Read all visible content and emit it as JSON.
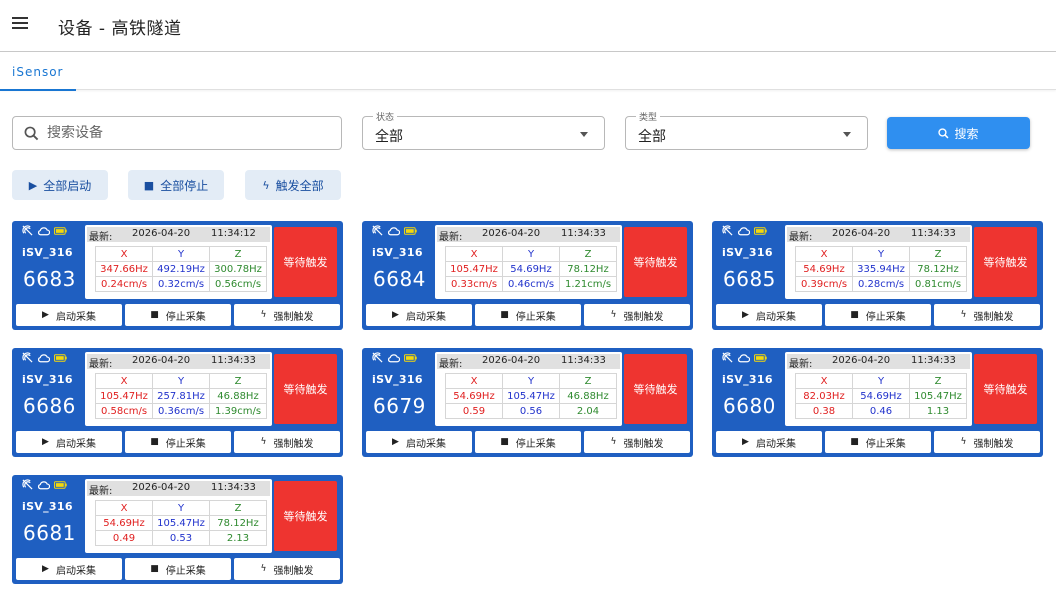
{
  "header": {
    "title": "设备 - 高铁隧道",
    "menu_icon": "hamburger-menu-icon"
  },
  "tabs": [
    {
      "label": "iSensor",
      "active": true
    }
  ],
  "filters": {
    "search_placeholder": "搜索设备",
    "status": {
      "legend": "状态",
      "value": "全部"
    },
    "type": {
      "legend": "类型",
      "value": "全部"
    },
    "search_button": "搜索"
  },
  "actions": {
    "start_all": "全部启动",
    "stop_all": "全部停止",
    "trigger_all": "触发全部"
  },
  "card_labels": {
    "latest": "最新:",
    "axes": [
      "X",
      "Y",
      "Z"
    ],
    "trigger_status": "等待触发",
    "start": "启动采集",
    "stop": "停止采集",
    "force": "强制触发"
  },
  "colors": {
    "primary": "#1f5fc1",
    "trigger": "#ee3430",
    "x": "#e02020",
    "y": "#2233cc",
    "z": "#2f8a2f",
    "search_button": "#2f8ff0"
  },
  "devices": [
    {
      "model": "iSV_316",
      "id": "6683",
      "date": "2026-04-20",
      "time": "11:34:12",
      "freq": [
        "347.66Hz",
        "492.19Hz",
        "300.78Hz"
      ],
      "vel": [
        "0.24cm/s",
        "0.32cm/s",
        "0.56cm/s"
      ]
    },
    {
      "model": "iSV_316",
      "id": "6684",
      "date": "2026-04-20",
      "time": "11:34:33",
      "freq": [
        "105.47Hz",
        "54.69Hz",
        "78.12Hz"
      ],
      "vel": [
        "0.33cm/s",
        "0.46cm/s",
        "1.21cm/s"
      ]
    },
    {
      "model": "iSV_316",
      "id": "6685",
      "date": "2026-04-20",
      "time": "11:34:33",
      "freq": [
        "54.69Hz",
        "335.94Hz",
        "78.12Hz"
      ],
      "vel": [
        "0.39cm/s",
        "0.28cm/s",
        "0.81cm/s"
      ]
    },
    {
      "model": "iSV_316",
      "id": "6686",
      "date": "2026-04-20",
      "time": "11:34:33",
      "freq": [
        "105.47Hz",
        "257.81Hz",
        "46.88Hz"
      ],
      "vel": [
        "0.58cm/s",
        "0.36cm/s",
        "1.39cm/s"
      ]
    },
    {
      "model": "iSV_316",
      "id": "6679",
      "date": "2026-04-20",
      "time": "11:34:33",
      "freq": [
        "54.69Hz",
        "105.47Hz",
        "46.88Hz"
      ],
      "vel": [
        "0.59",
        "0.56",
        "2.04"
      ]
    },
    {
      "model": "iSV_316",
      "id": "6680",
      "date": "2026-04-20",
      "time": "11:34:33",
      "freq": [
        "82.03Hz",
        "54.69Hz",
        "105.47Hz"
      ],
      "vel": [
        "0.38",
        "0.46",
        "1.13"
      ]
    },
    {
      "model": "iSV_316",
      "id": "6681",
      "date": "2026-04-20",
      "time": "11:34:33",
      "freq": [
        "54.69Hz",
        "105.47Hz",
        "78.12Hz"
      ],
      "vel": [
        "0.49",
        "0.53",
        "2.13"
      ]
    }
  ]
}
